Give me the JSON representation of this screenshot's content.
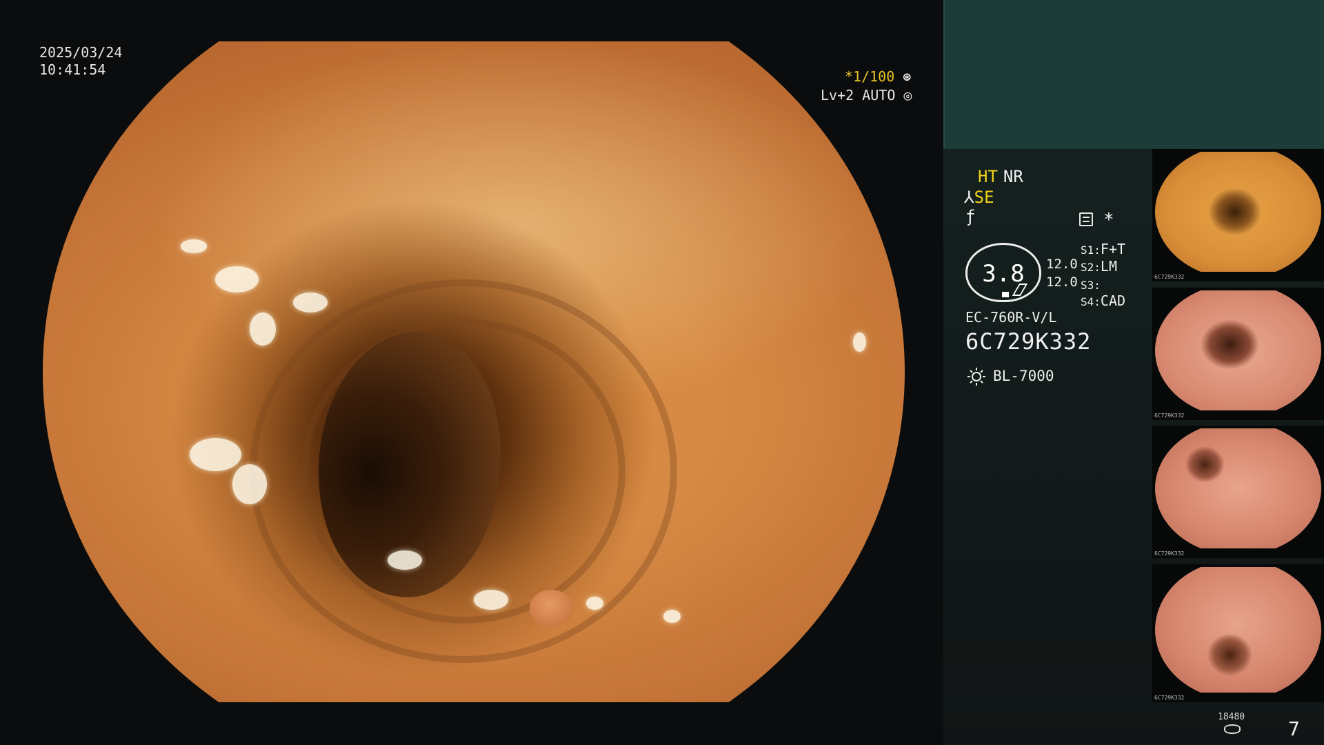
{
  "overlay": {
    "date": "2025/03/24",
    "time": "10:41:54",
    "shutter": "*1/100",
    "level": "Lv+2 AUTO"
  },
  "status": {
    "ht": "HT",
    "nr": "NR",
    "se": "SE",
    "oval_value": "3.8",
    "val1": "12.0",
    "val2": "12.0",
    "s1_label": "S1:",
    "s1_value": "F+T",
    "s2_label": "S2:",
    "s2_value": "LM",
    "s3_label": "S3:",
    "s3_value": "",
    "s4_label": "S4:",
    "s4_value": "CAD"
  },
  "scope": {
    "model": "EC-760R-V/L",
    "serial": "6C729K332",
    "light_source": "BL-7000"
  },
  "storage": {
    "count": "18480",
    "images": "7"
  },
  "thumbnails": [
    {
      "label": "6C729K332"
    },
    {
      "label": "6C729K332"
    },
    {
      "label": "6C729K332"
    },
    {
      "label": "6C729K332"
    }
  ],
  "colors": {
    "accent_yellow": "#f2d21a",
    "panel_teal": "#1d3c38"
  }
}
